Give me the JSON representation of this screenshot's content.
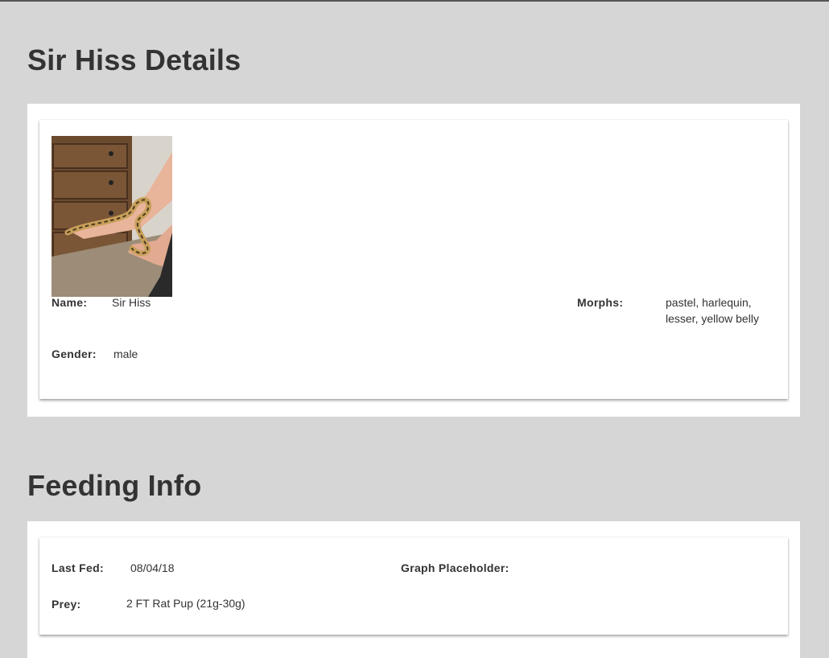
{
  "page": {
    "title": "Sir Hiss Details"
  },
  "details": {
    "photo_name": "snake-photo",
    "name_label": "Name:",
    "name_value": "Sir Hiss",
    "gender_label": "Gender:",
    "gender_value": "male",
    "morphs_label": "Morphs:",
    "morphs_value": "pastel, harlequin, lesser, yellow belly"
  },
  "feeding": {
    "title": "Feeding Info",
    "last_fed_label": "Last Fed:",
    "last_fed_value": "08/04/18",
    "prey_label": "Prey:",
    "prey_value": "2 FT Rat Pup (21g-30g)",
    "graph_label": "Graph Placeholder:"
  },
  "colors": {
    "background": "#d6d6d6",
    "panel": "#ffffff",
    "text": "#333333"
  }
}
